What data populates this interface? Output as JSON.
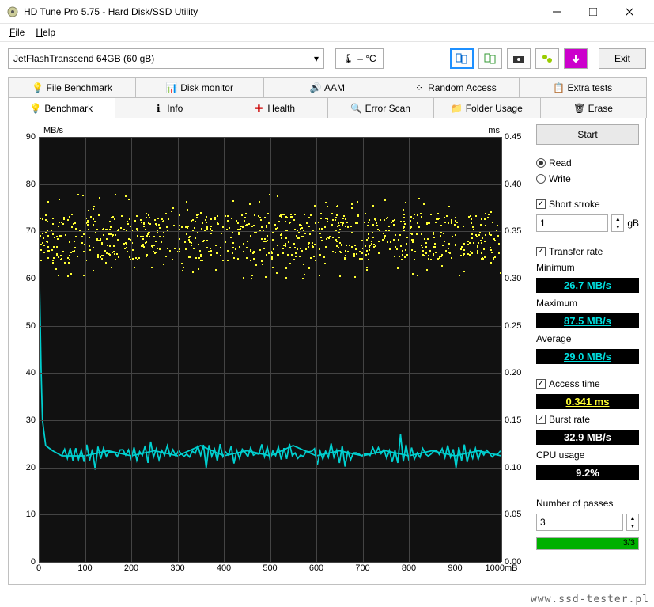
{
  "window": {
    "title": "HD Tune Pro 5.75 - Hard Disk/SSD Utility"
  },
  "menu": {
    "file": "File",
    "help": "Help"
  },
  "toolbar": {
    "drive": "JetFlashTranscend 64GB (60 gB)",
    "temp": "– °C",
    "exit": "Exit"
  },
  "tabs": {
    "top": [
      "File Benchmark",
      "Disk monitor",
      "AAM",
      "Random Access",
      "Extra tests"
    ],
    "bottom": [
      "Benchmark",
      "Info",
      "Health",
      "Error Scan",
      "Folder Usage",
      "Erase"
    ]
  },
  "side": {
    "start": "Start",
    "read": "Read",
    "write": "Write",
    "short_stroke": "Short stroke",
    "short_val": "1",
    "short_unit": "gB",
    "transfer_rate": "Transfer rate",
    "min_lbl": "Minimum",
    "min_val": "26.7 MB/s",
    "max_lbl": "Maximum",
    "max_val": "87.5 MB/s",
    "avg_lbl": "Average",
    "avg_val": "29.0 MB/s",
    "access_lbl": "Access time",
    "access_val": "0.341 ms",
    "burst_lbl": "Burst rate",
    "burst_val": "32.9 MB/s",
    "cpu_lbl": "CPU usage",
    "cpu_val": "9.2%",
    "passes_lbl": "Number of passes",
    "passes_val": "3",
    "progress_txt": "3/3"
  },
  "watermark": "www.ssd-tester.pl",
  "chart_data": {
    "type": "line+scatter",
    "title": "",
    "xlabel": "mB",
    "ylabel_left": "MB/s",
    "ylabel_right": "ms",
    "xlim": [
      0,
      1000
    ],
    "ylim_left": [
      0,
      90
    ],
    "ylim_right": [
      0,
      0.45
    ],
    "xticks": [
      0,
      100,
      200,
      300,
      400,
      500,
      600,
      700,
      800,
      900,
      1000
    ],
    "yticks_left": [
      0,
      10,
      20,
      30,
      40,
      50,
      60,
      70,
      80,
      90
    ],
    "yticks_right": [
      0,
      0.05,
      0.1,
      0.15,
      0.2,
      0.25,
      0.3,
      0.35,
      0.4,
      0.45
    ],
    "series": [
      {
        "name": "Transfer rate (blue line)",
        "axis": "left",
        "x": [
          0,
          2,
          5,
          8,
          15,
          30,
          50,
          100,
          150,
          200,
          250,
          300,
          350,
          400,
          450,
          500,
          550,
          600,
          650,
          700,
          750,
          800,
          850,
          900,
          950,
          1000
        ],
        "y": [
          87.5,
          60,
          45,
          35,
          30,
          29,
          28,
          28,
          29,
          28,
          29,
          28,
          30,
          28,
          29,
          28,
          30,
          28,
          29,
          28,
          29,
          28,
          29,
          28,
          29,
          28
        ]
      },
      {
        "name": "Access time (yellow dots)",
        "axis": "right",
        "note": "dense scatter cloud roughly centered 0.33-0.36 ms across full x range",
        "approx_band": {
          "low": 0.32,
          "high": 0.37,
          "outlier_low": 0.3,
          "outlier_high": 0.39
        }
      }
    ]
  }
}
